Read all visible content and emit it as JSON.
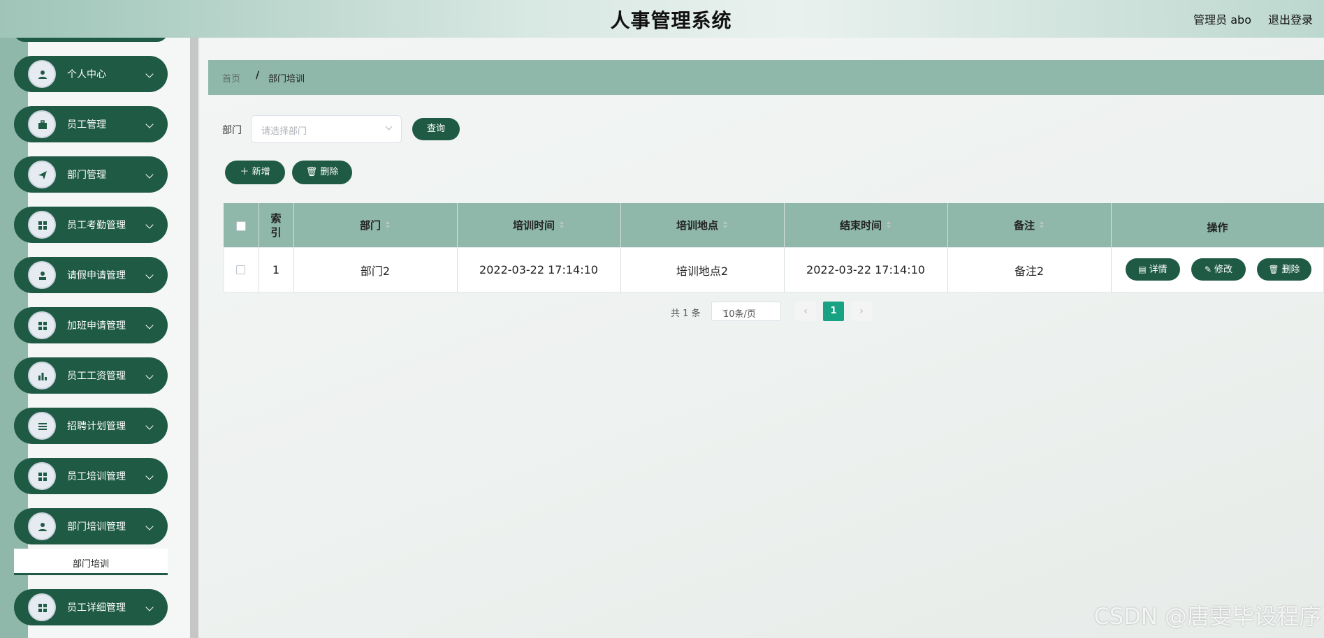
{
  "header": {
    "title": "人事管理系统",
    "user": "管理员 abo",
    "logout": "退出登录"
  },
  "sidebar": {
    "items": [
      {
        "label": "个人中心",
        "icon": "user-icon"
      },
      {
        "label": "员工管理",
        "icon": "briefcase-icon"
      },
      {
        "label": "部门管理",
        "icon": "send-icon"
      },
      {
        "label": "员工考勤管理",
        "icon": "grid-icon"
      },
      {
        "label": "请假申请管理",
        "icon": "person-icon"
      },
      {
        "label": "加班申请管理",
        "icon": "grid-icon"
      },
      {
        "label": "员工工资管理",
        "icon": "bar-chart-icon"
      },
      {
        "label": "招聘计划管理",
        "icon": "list-icon"
      },
      {
        "label": "员工培训管理",
        "icon": "grid-icon"
      },
      {
        "label": "部门培训管理",
        "icon": "person-icon"
      },
      {
        "label": "员工详细管理",
        "icon": "grid-icon"
      }
    ],
    "submenu_label": "部门培训"
  },
  "breadcrumb": {
    "home": "首页",
    "separator": "/",
    "current": "部门培训"
  },
  "search": {
    "label": "部门",
    "placeholder": "请选择部门",
    "query_button": "查询"
  },
  "toolbar": {
    "add_label": "新增",
    "delete_label": "删除"
  },
  "table": {
    "columns": [
      "索引",
      "部门",
      "培训时间",
      "培训地点",
      "结束时间",
      "备注",
      "操作"
    ],
    "rows": [
      {
        "index": "1",
        "department": "部门2",
        "train_time": "2022-03-22 17:14:10",
        "location": "培训地点2",
        "end_time": "2022-03-22 17:14:10",
        "remark": "备注2"
      }
    ],
    "actions": {
      "detail": "详情",
      "edit": "修改",
      "delete": "删除"
    }
  },
  "pagination": {
    "total_text": "共 1 条",
    "page_size": "10条/页",
    "current_page": "1"
  },
  "watermark": "CSDN @唐雯毕设程序",
  "colors": {
    "primary": "#1f5a45",
    "accent": "#8fb8aa",
    "active_page": "#17a383"
  }
}
